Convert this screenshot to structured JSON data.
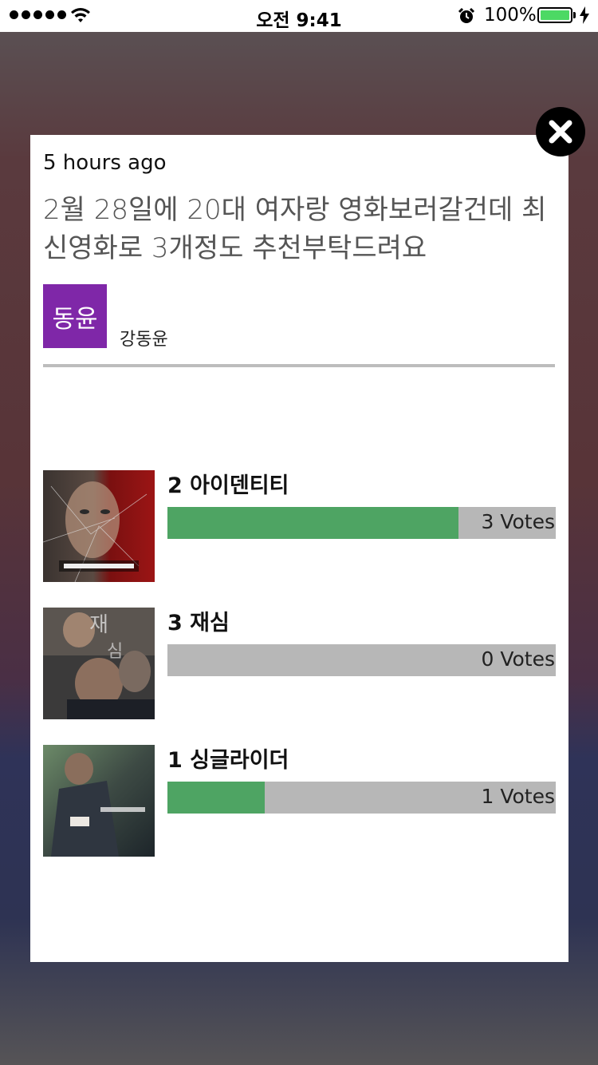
{
  "status_bar": {
    "time": "오전 9:41",
    "battery_percent": "100%",
    "signal_bars": 5,
    "icons": [
      "signal-dots-icon",
      "wifi-icon",
      "alarm-icon",
      "battery-icon",
      "charging-bolt-icon"
    ]
  },
  "post": {
    "time_ago": "5 hours ago",
    "question": "2월 28일에 20대 여자랑 영화보러갈건데 최신영화로 3개정도 추천부탁드려요",
    "author_avatar_text": "동윤",
    "author_name": "강동윤",
    "avatar_color": "#7f27a8"
  },
  "options": [
    {
      "title": "2 아이덴티티",
      "votes_label": "3 Votes",
      "votes": 3,
      "vote_fraction": 0.75
    },
    {
      "title": "3 재심",
      "votes_label": "0 Votes",
      "votes": 0,
      "vote_fraction": 0
    },
    {
      "title": "1 싱글라이더",
      "votes_label": "1 Votes",
      "votes": 1,
      "vote_fraction": 0.25
    }
  ],
  "colors": {
    "bar_fill": "#4ea463",
    "bar_track": "#b7b7b7"
  },
  "close_icon": "close-icon"
}
